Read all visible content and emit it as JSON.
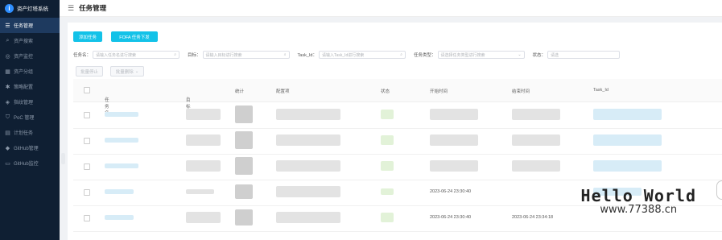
{
  "brand": {
    "title": "资产灯塔系统",
    "icon": "i"
  },
  "menu": [
    {
      "label": "任务管理",
      "icon": "list-icon",
      "glyph": "☰",
      "active": true
    },
    {
      "label": "资产搜索",
      "icon": "search-icon",
      "glyph": "⌕"
    },
    {
      "label": "资产监控",
      "icon": "monitor-icon",
      "glyph": "◎"
    },
    {
      "label": "资产分组",
      "icon": "group-icon",
      "glyph": "▦"
    },
    {
      "label": "策略配置",
      "icon": "gear-icon",
      "glyph": "✱"
    },
    {
      "label": "指纹管理",
      "icon": "fingerprint-icon",
      "glyph": "◈"
    },
    {
      "label": "PoC 管理",
      "icon": "poc-icon",
      "glyph": "⛉"
    },
    {
      "label": "计划任务",
      "icon": "schedule-icon",
      "glyph": "▤"
    },
    {
      "label": "GitHub管理",
      "icon": "github-icon",
      "glyph": "◆"
    },
    {
      "label": "GitHub监控",
      "icon": "github-monitor-icon",
      "glyph": "▭"
    }
  ],
  "header": {
    "title": "任务管理",
    "menu_icon": "☰"
  },
  "toolbar": {
    "add_label": "添加任务",
    "fofa_label": "FOFA 任务下发"
  },
  "filters": {
    "task_name_label": "任务名：",
    "task_name_placeholder": "请输入任务名进行搜索",
    "target_label": "目标：",
    "target_placeholder": "请输入目标进行搜索",
    "task_id_label": "Task_Id：",
    "task_id_placeholder": "请输入Task_Id进行搜索",
    "task_type_label": "任务类型：",
    "task_type_placeholder": "请选择任务类型进行搜索",
    "status_label": "状态：",
    "status_placeholder": "请选"
  },
  "batch": {
    "stop_label": "批量停止",
    "delete_label": "批量删除"
  },
  "table": {
    "columns": [
      "任务名",
      "目标",
      "统计",
      "配置项",
      "状态",
      "开始时间",
      "结束时间",
      "Task_Id"
    ],
    "rows": [
      {
        "start": "",
        "end": ""
      },
      {
        "start": "",
        "end": ""
      },
      {
        "start": "",
        "end": ""
      },
      {
        "start": "2023-06-24 23:30:40",
        "end": ""
      },
      {
        "start": "2023-06-24 23:30:40",
        "end": "2023-06-24 23:34:18"
      }
    ]
  },
  "watermark": {
    "line1": "Hello World",
    "line2": "www.77388.cn"
  }
}
